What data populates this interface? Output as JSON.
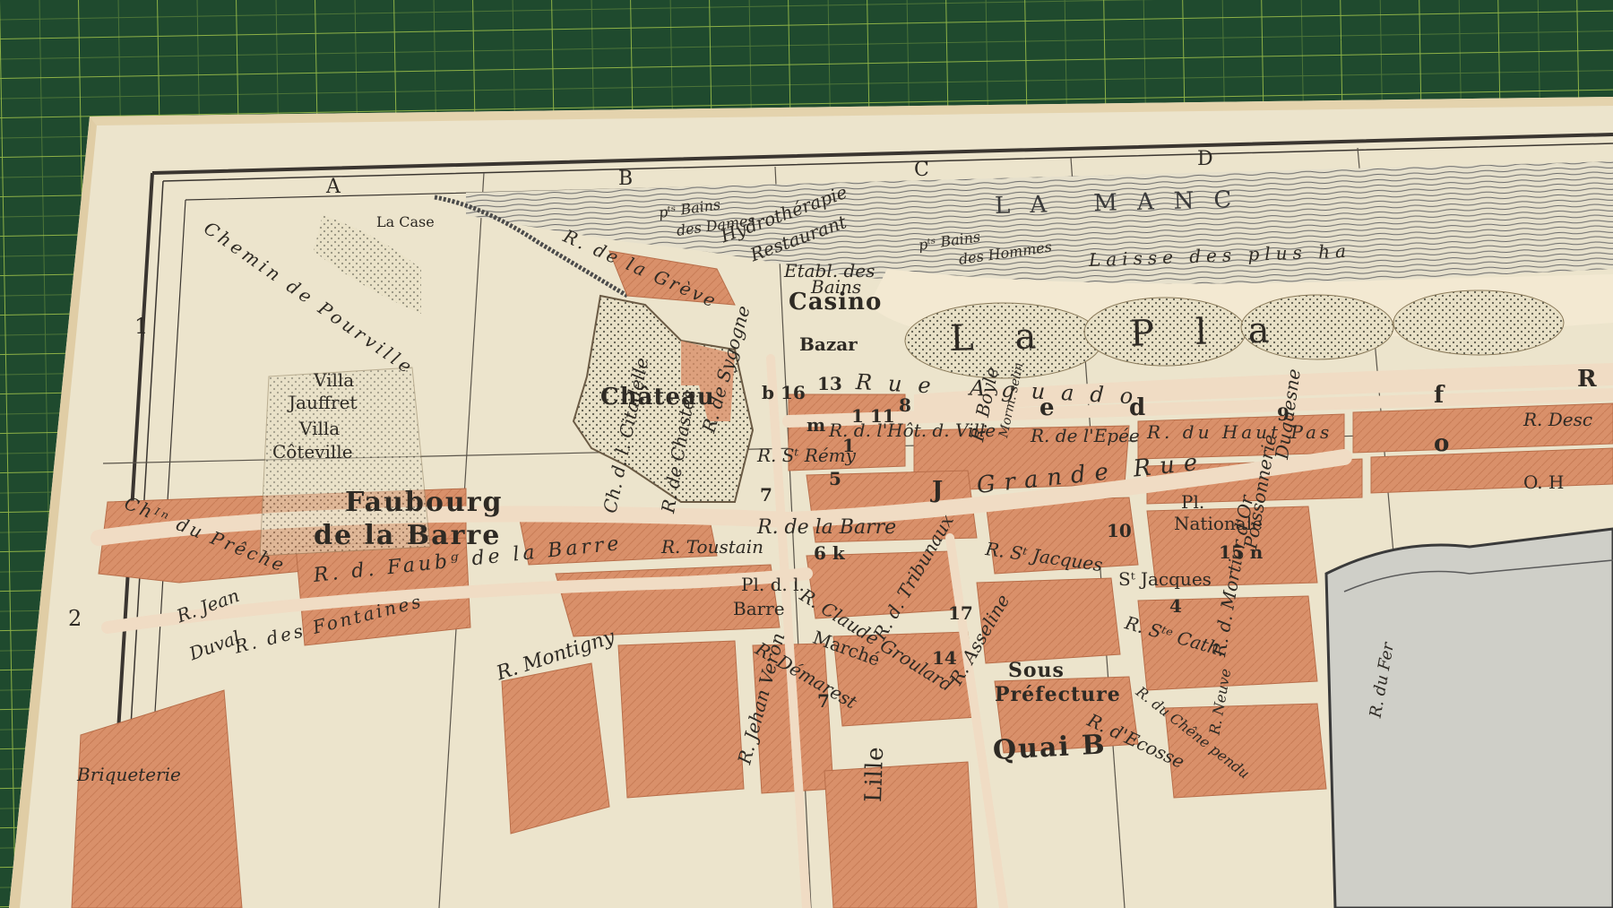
{
  "colors": {
    "cutting_mat": "#1f4a2e",
    "mat_grid": "#9fc24a",
    "paper": "#ece4cc",
    "paper_edge": "#e4d3ad",
    "buildings": "#d9906a",
    "streets": "#f0dcc4",
    "sea_hatch": "#6a6a6a",
    "ink": "#2e2a24"
  },
  "icons": {
    "park": "dotted-park-pattern",
    "sea": "wave-hatch-pattern",
    "cliff": "hachure-pattern"
  },
  "grid": {
    "columns": [
      "A",
      "B",
      "C",
      "D"
    ],
    "rows": [
      "1",
      "2"
    ]
  },
  "labels": {
    "sea": "LA MANC",
    "plage": "La Pla",
    "laisse": "Laisse des plus ha",
    "bains_dames_1": "pᵗˢ Bains",
    "bains_dames_2": "des Dames",
    "bains_hommes_1": "pᵗˢ Bains",
    "bains_hommes_2": "des Hommes",
    "hydrotherapie": "Hydrothérapie",
    "restaurant": "Restaurant",
    "etabl_1": "Etabl. des",
    "etabl_2": "Bains",
    "casino": "Casino",
    "bazar": "Bazar",
    "chateau": "Château",
    "lacase": "La Case",
    "chemin_pourville": "Chemin de Pourville",
    "villa_jauffret_1": "Villa",
    "villa_jauffret_2": "Jauffret",
    "villa_coteville_1": "Villa",
    "villa_coteville_2": "Côteville",
    "faubourg_1": "Faubourg",
    "faubourg_2": "de la Barre",
    "ch_preche": "Chᴵⁿ du Prêche",
    "r_greve": "R. de la Grève",
    "r_aguado": "Rue Aguado",
    "r_sygogne": "R. de Sygogne",
    "r_hotel_ville": "R. d. l'Hôt. d. Ville",
    "r_st_remy": "R. Sᵗ Rémy",
    "r_epee": "R. de l'Epée",
    "r_haut_pas": "R. du Haut Pas",
    "grande_rue": "Grande Rue",
    "r_barre": "R. de la Barre",
    "r_toustain": "R. Toustain",
    "r_faubg_barre": "R. d. Faubᵍ de la Barre",
    "r_fontaines": "R. des Fontaines",
    "r_jean_duval_1": "R. Jean",
    "r_jean_duval_2": "Duval",
    "r_montigny": "R. Montigny",
    "pl_barre_1": "Pl. d. l.",
    "pl_barre_2": "Barre",
    "r_claude_groulard": "R. Claude Groulard",
    "marche": "Marché",
    "r_demarest": "R. Démarest",
    "r_jehan_veron": "R. Jehan Veron",
    "r_tribunaux": "R. d. Tribunaux",
    "r_asseline": "R. Asseline",
    "sous_prefecture_1": "Sous",
    "sous_prefecture_2": "Préfecture",
    "quai": "Quai B",
    "r_st_jacques": "R. Sᵗ Jacques",
    "st_jacques": "Sᵗ Jacques",
    "pl_nationale_1": "Pl.",
    "pl_nationale_2": "Nationale",
    "r_ste_cath": "R. Sᵗᵉ Cath.",
    "r_mortier": "R. d. Mortier d'Or",
    "duquesne": "Duquesne",
    "poissonnerie": "Poissonnerie",
    "briqueterie": "Briqueterie",
    "lille": "Lille",
    "r_chastes": "R. de Chastes",
    "ch_citadelle": "Ch. d. l. Citadelle",
    "r_desc": "R. Desc",
    "r_boyle": "R. Boyle",
    "r_morm": "Morm. selin",
    "r_chene_pendu": "R. du Chêne pendu",
    "r_ecosse": "R. d'Ecosse",
    "r_neuve": "R. Neuve",
    "r_du_fer": "R. du Fer",
    "faubourg_h": "O. H"
  },
  "numbers": {
    "n16": "b 16",
    "n13": "13",
    "n11": "1 11",
    "n8": "8",
    "nm": "m",
    "n1": "1",
    "n5": "5",
    "n7a": "7",
    "n6k": "6 k",
    "n10": "10",
    "n15n": "15 n",
    "n17": "17",
    "n14": "14",
    "n4": "4",
    "n7b": "7",
    "n9": "9",
    "nf": "f",
    "no": "o",
    "nJ": "J",
    "ne": "e",
    "nd": "d",
    "nR": "R"
  }
}
